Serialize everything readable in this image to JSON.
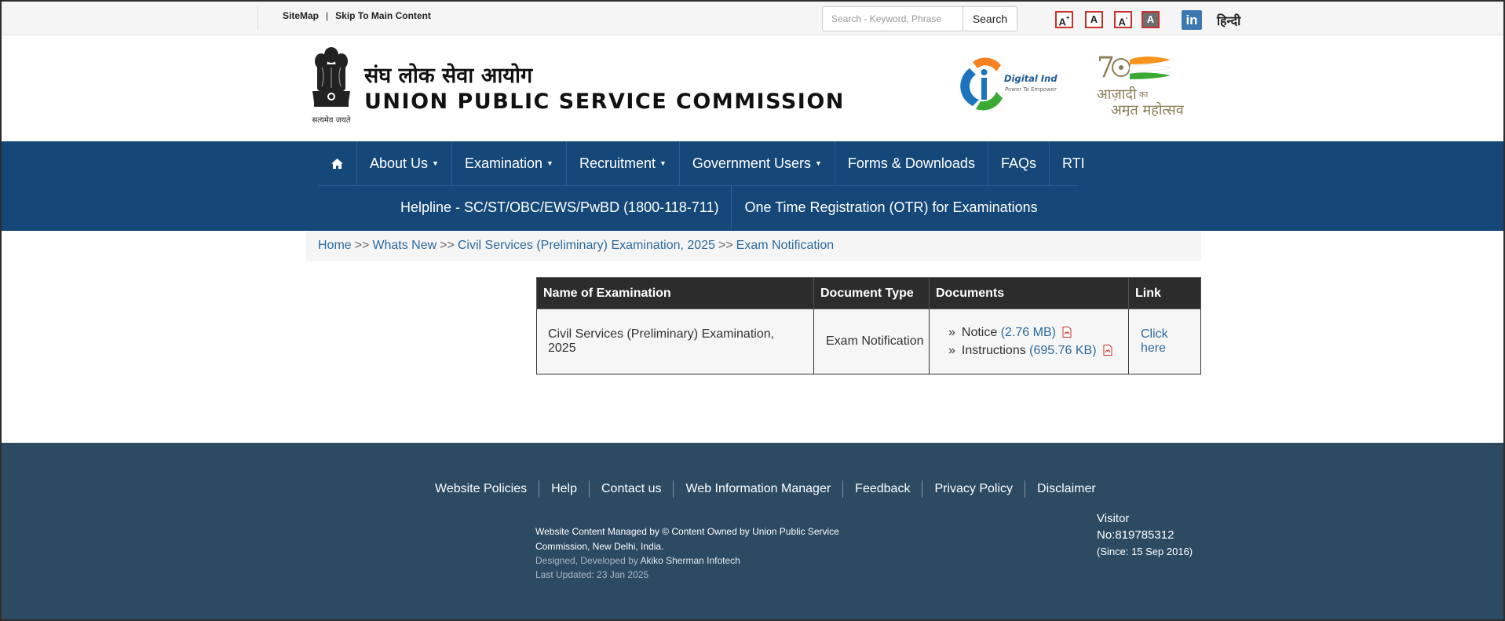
{
  "topbar": {
    "sitemap": "SiteMap",
    "separator": "|",
    "skip": "Skip To Main Content",
    "search_placeholder": "Search - Keyword, Phrase",
    "search_button": "Search",
    "font_increase": "A",
    "font_increase_sup": "+",
    "font_normal": "A",
    "font_decrease": "A",
    "font_decrease_sup": "-",
    "contrast": "A",
    "linkedin": "in",
    "hindi": "हिन्दी"
  },
  "header": {
    "title_hi": "संघ लोक सेवा आयोग",
    "title_en": "UNION PUBLIC SERVICE COMMISSION",
    "emblem_motto": "सत्यमेव जयते",
    "digital_india": "Digital India",
    "digital_india_tagline": "Power To Empower",
    "azadi_line1": "आज़ादी",
    "azadi_ka": "का",
    "azadi_line2": "अमृत महोत्सव"
  },
  "nav": {
    "row1": [
      {
        "label": "About Us",
        "dropdown": true
      },
      {
        "label": "Examination",
        "dropdown": true
      },
      {
        "label": "Recruitment",
        "dropdown": true
      },
      {
        "label": "Government Users",
        "dropdown": true
      },
      {
        "label": "Forms & Downloads",
        "dropdown": false
      },
      {
        "label": "FAQs",
        "dropdown": false
      },
      {
        "label": "RTI",
        "dropdown": false
      }
    ],
    "row2": [
      {
        "label": "Helpline - SC/ST/OBC/EWS/PwBD (1800-118-711)"
      },
      {
        "label": "One Time Registration (OTR) for Examinations"
      }
    ],
    "caret": "▼",
    "home_icon": "home-icon"
  },
  "breadcrumb": {
    "items": [
      "Home",
      "Whats New",
      "Civil Services (Preliminary) Examination, 2025",
      "Exam Notification"
    ],
    "separator": ">>"
  },
  "table": {
    "headers": [
      "Name of Examination",
      "Document Type",
      "Documents",
      "Link"
    ],
    "row": {
      "name": "Civil Services (Preliminary) Examination, 2025",
      "type": "Exam Notification",
      "documents": [
        {
          "label": "Notice",
          "size": "(2.76 MB)"
        },
        {
          "label": "Instructions",
          "size": "(695.76 KB)"
        }
      ],
      "bullet": "»",
      "link": "Click here"
    }
  },
  "footer": {
    "links": [
      "Website Policies",
      "Help",
      "Contact us",
      "Web Information Manager",
      "Feedback",
      "Privacy Policy",
      "Disclaimer"
    ],
    "managed": "Website Content Managed by © Content Owned by Union Public Service Commission, New Delhi, India.",
    "designed_prefix": "Designed, Developed by",
    "developer": "Akiko Sherman Infotech",
    "last_updated": "Last Updated: 23 Jan 2025",
    "visitor_label": "Visitor",
    "visitor_no": "No:819785312",
    "visitor_since": "(Since: 15 Sep 2016)"
  },
  "colors": {
    "nav_bg": "#154879",
    "footer_bg": "#2d4a63",
    "link": "#2c6a9e",
    "table_header": "#2c2c2c",
    "accent_red": "#c9302c"
  }
}
